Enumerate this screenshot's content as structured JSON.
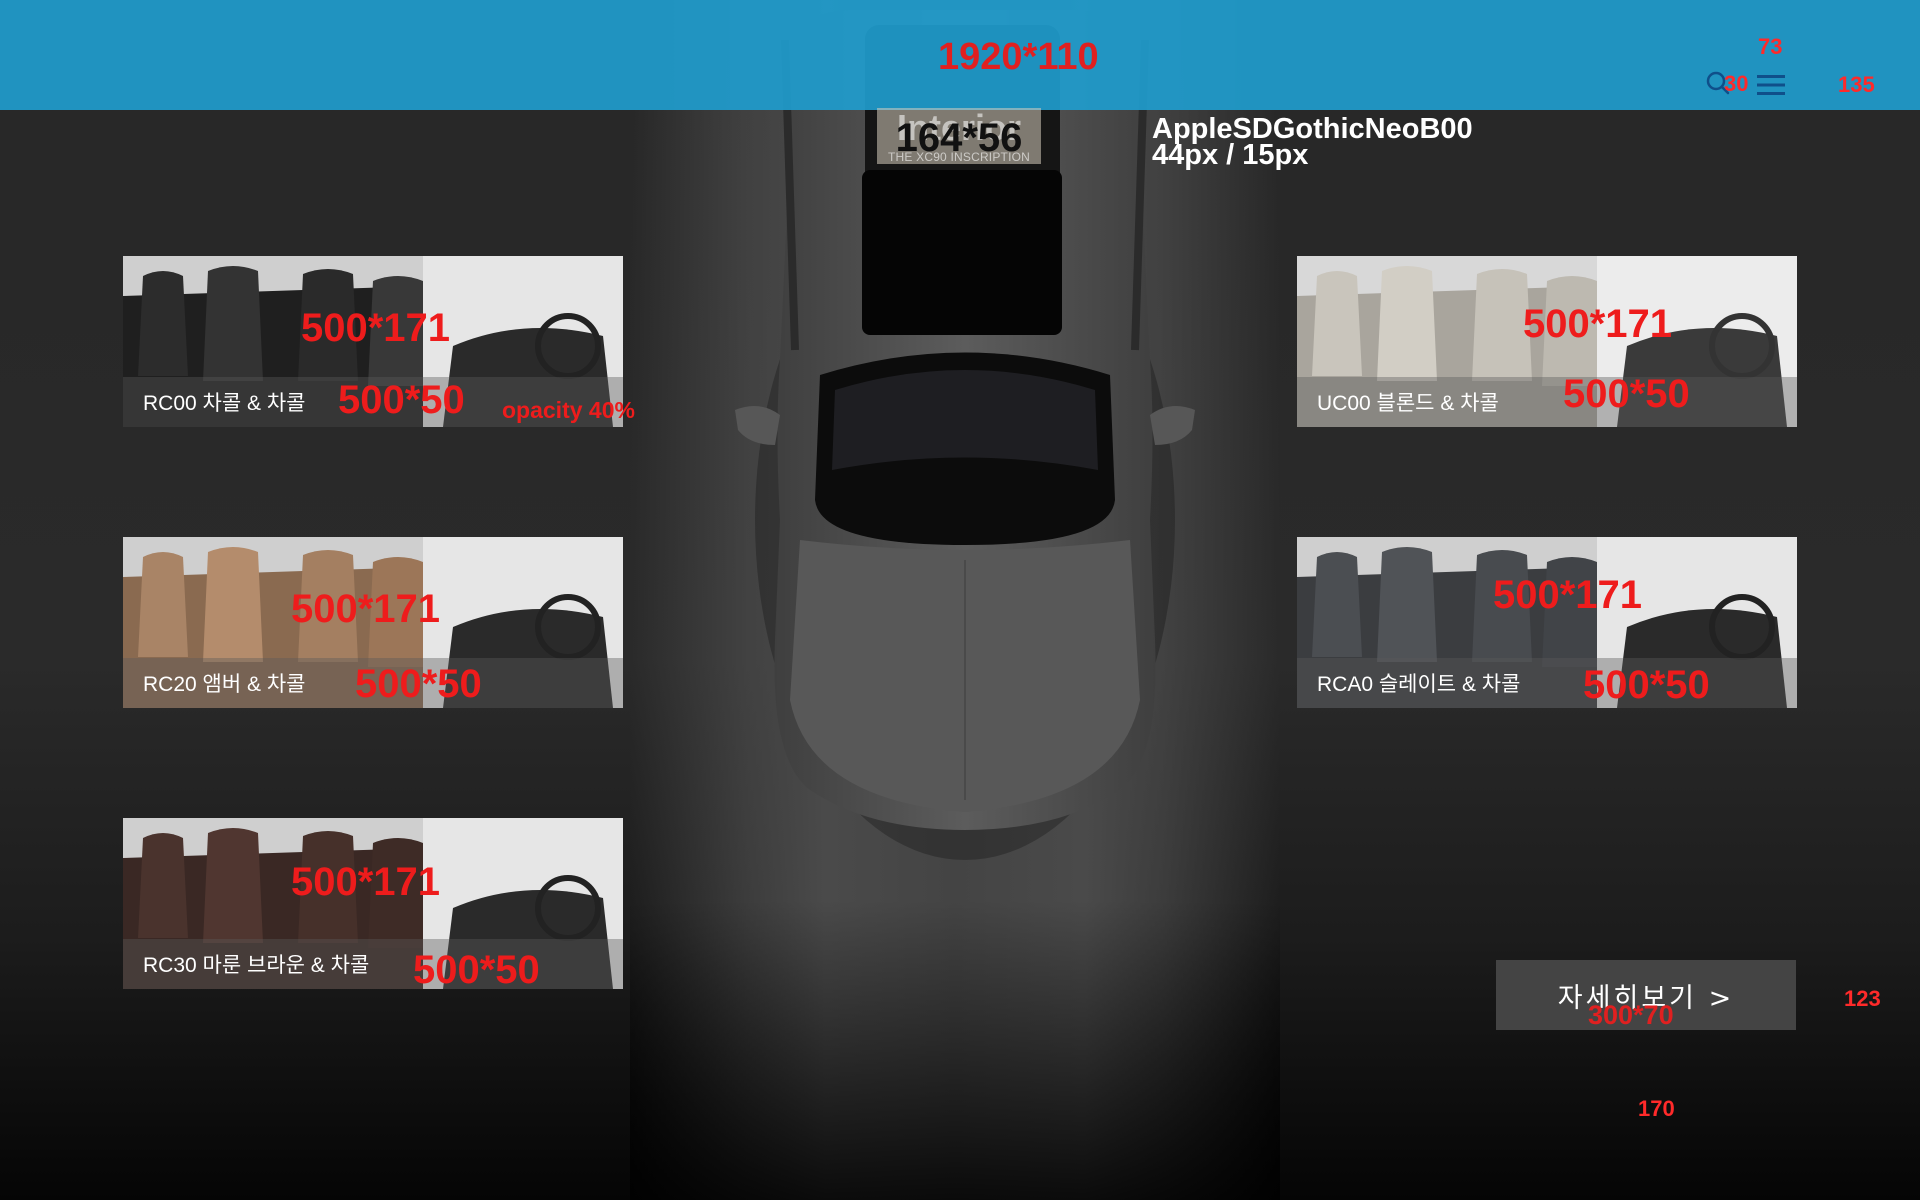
{
  "header": {
    "dimension_label": "1920*110",
    "right_annotations": {
      "top": "73",
      "gap": "30",
      "right": "135"
    },
    "icons": [
      "search-icon",
      "menu-icon"
    ],
    "accent_color": "#209ccd"
  },
  "title": {
    "text": "Interior",
    "subtitle": "THE XC90 INSCRIPTION",
    "dimension_label": "164*56",
    "font_spec_line1": "AppleSDGothicNeoB00",
    "font_spec_line2": "44px / 15px"
  },
  "cards": [
    {
      "label": "RC00 차콜 & 차콜",
      "size_label": "500*171",
      "strip_label": "500*50",
      "note": "opacity 40%"
    },
    {
      "label": "RC20 앰버 & 차콜",
      "size_label": "500*171",
      "strip_label": "500*50"
    },
    {
      "label": "RC30 마룬 브라운 & 차콜",
      "size_label": "500*171",
      "strip_label": "500*50"
    },
    {
      "label": "UC00 블론드 & 차콜",
      "size_label": "500*171",
      "strip_label": "500*50"
    },
    {
      "label": "RCA0 슬레이트 & 차콜",
      "size_label": "500*171",
      "strip_label": "500*50"
    }
  ],
  "cta": {
    "label": "자세히보기  >",
    "dimension_label": "300*70",
    "side_annotation": "123",
    "bottom_annotation": "170"
  },
  "colors": {
    "annotation": "#e02020",
    "background": "#272727"
  }
}
